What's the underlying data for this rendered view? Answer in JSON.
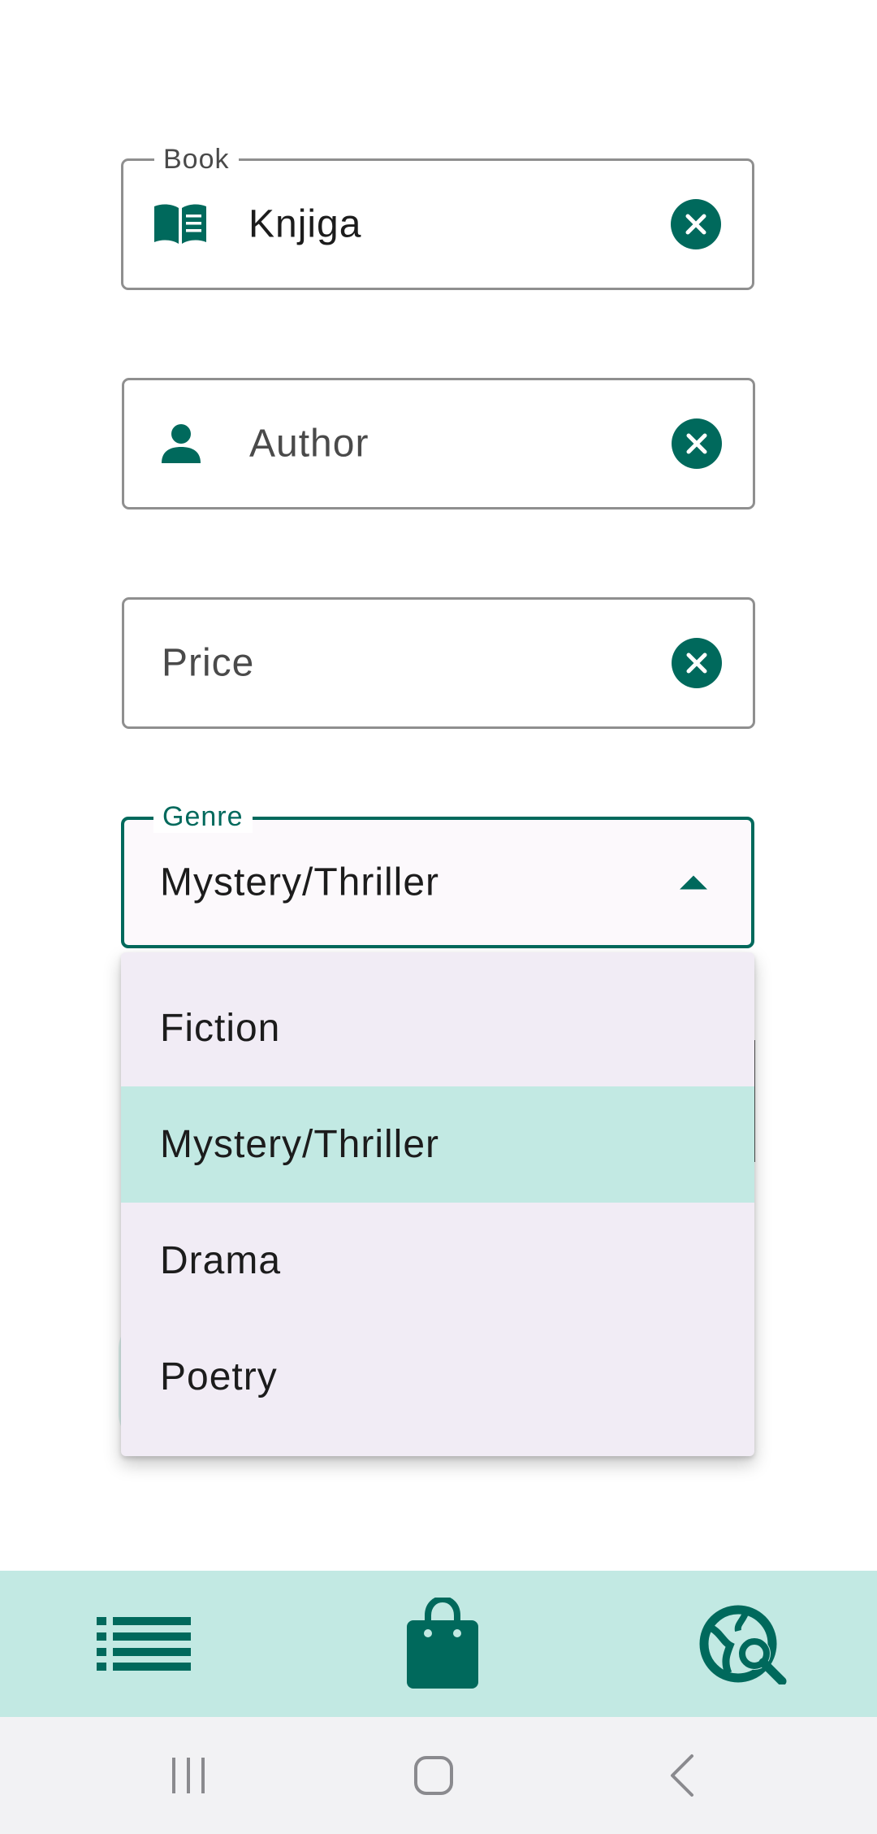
{
  "form": {
    "book": {
      "label": "Book",
      "value": "Knjiga",
      "icon": "open-book-icon"
    },
    "author": {
      "placeholder": "Author",
      "icon": "person-icon"
    },
    "price": {
      "placeholder": "Price"
    },
    "genre": {
      "label": "Genre",
      "selected": "Mystery/Thriller",
      "options": [
        "Fiction",
        "Mystery/Thriller",
        "Drama",
        "Poetry"
      ]
    }
  },
  "bottom_nav": {
    "items": [
      {
        "icon": "list-icon"
      },
      {
        "icon": "shopping-bag-icon"
      },
      {
        "icon": "travel-explore-icon"
      }
    ]
  },
  "system_nav": {
    "items": [
      {
        "icon": "recent-apps-icon"
      },
      {
        "icon": "home-icon"
      },
      {
        "icon": "back-icon"
      }
    ]
  },
  "colors": {
    "accent": "#00695c",
    "nav_background": "#c2e9e3",
    "menu_background": "#f1ecf5",
    "selected_item": "#c2e9e3"
  }
}
